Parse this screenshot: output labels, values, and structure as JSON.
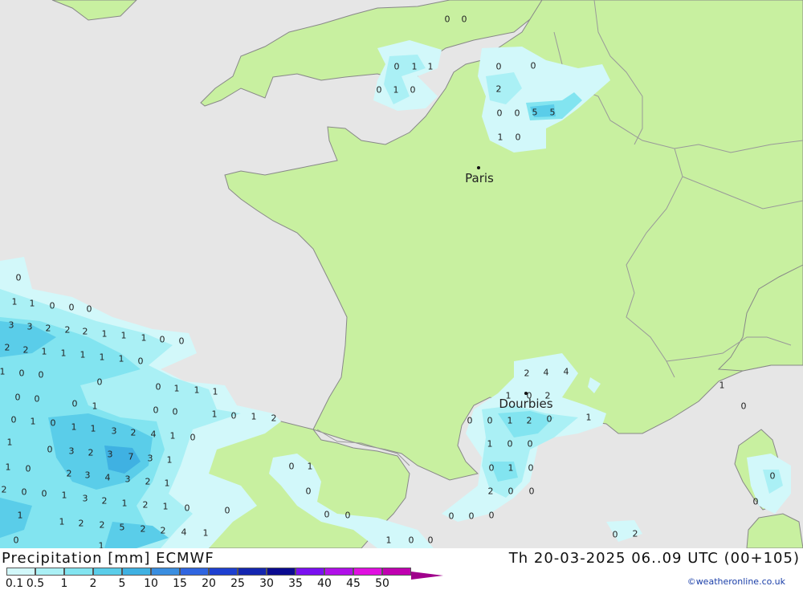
{
  "footer": {
    "title": "Precipitation [mm] ECMWF",
    "run_info": "Th 20-03-2025 06..09 UTC (00+105)",
    "credit": "©weatheronline.co.uk"
  },
  "legend": {
    "labels": [
      "0.1",
      "0.5",
      "1",
      "2",
      "5",
      "10",
      "15",
      "20",
      "25",
      "30",
      "35",
      "40",
      "45",
      "50"
    ],
    "colors": [
      "#d2f8fa",
      "#aaf0f5",
      "#82e4f0",
      "#5acde9",
      "#3fb1e2",
      "#3a8ee0",
      "#3065e0",
      "#1e40d0",
      "#1426b0",
      "#0a0a90",
      "#7a10f0",
      "#b010e8",
      "#e010e0",
      "#c000b0",
      "#a0008c"
    ]
  },
  "colors": {
    "sea": "#e6e6e6",
    "land": "#c8f0a0",
    "border": "#888888"
  },
  "cities": [
    {
      "name": "Paris"
    },
    {
      "name": "Dourbies"
    }
  ],
  "values": [
    "0",
    "0",
    "0",
    "1",
    "1",
    "0",
    "1",
    "0",
    "0",
    "0",
    "2",
    "0",
    "0",
    "5",
    "5",
    "1",
    "0",
    "0",
    "1",
    "1",
    "0",
    "0",
    "0",
    "3",
    "3",
    "2",
    "2",
    "2",
    "1",
    "1",
    "1",
    "0",
    "0",
    "2",
    "2",
    "1",
    "1",
    "1",
    "1",
    "1",
    "0",
    "1",
    "0",
    "0",
    "0",
    "0",
    "1",
    "1",
    "1",
    "0",
    "0",
    "0",
    "1",
    "0",
    "0",
    "1",
    "0",
    "1",
    "2",
    "0",
    "1",
    "0",
    "1",
    "1",
    "3",
    "2",
    "4",
    "1",
    "0",
    "1",
    "0",
    "3",
    "2",
    "3",
    "7",
    "3",
    "1",
    "1",
    "0",
    "2",
    "3",
    "4",
    "3",
    "2",
    "1",
    "2",
    "0",
    "0",
    "1",
    "3",
    "2",
    "1",
    "2",
    "1",
    "0",
    "1",
    "1",
    "2",
    "2",
    "5",
    "2",
    "2",
    "4",
    "1",
    "0",
    "1",
    "0",
    "1",
    "0",
    "0",
    "0",
    "0",
    "0",
    "0",
    "1",
    "0",
    "0",
    "2",
    "4",
    "4",
    "1",
    "0",
    "2",
    "0",
    "0",
    "1",
    "2",
    "0",
    "1",
    "1",
    "0",
    "0",
    "0",
    "1",
    "0",
    "2",
    "0",
    "0",
    "1",
    "0",
    "0",
    "0",
    "0",
    "2",
    "0",
    "0"
  ]
}
